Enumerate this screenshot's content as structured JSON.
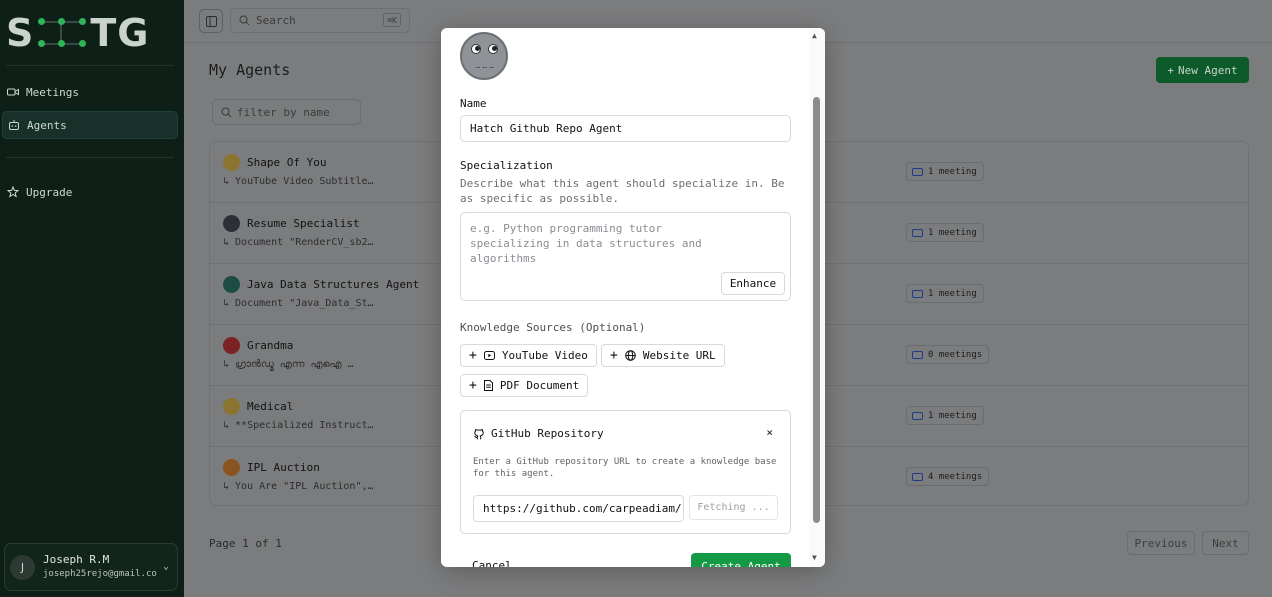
{
  "app": {
    "logo_left": "S",
    "logo_right": "TG"
  },
  "sidebar": {
    "items": [
      {
        "label": "Meetings",
        "icon": "video-icon"
      },
      {
        "label": "Agents",
        "icon": "bot-icon"
      },
      {
        "label": "Upgrade",
        "icon": "star-icon"
      }
    ],
    "user": {
      "initial": "J",
      "name": "Joseph R.M",
      "email": "joseph25rejo@gmail.co"
    }
  },
  "topbar": {
    "search_placeholder": "Search",
    "shortcut": "⌘K"
  },
  "page": {
    "title": "My Agents",
    "new_agent_label": "New Agent",
    "filter_placeholder": "filter by name",
    "pagination": {
      "info": "Page 1 of 1",
      "previous": "Previous",
      "next": "Next"
    }
  },
  "agents": [
    {
      "name": "Shape Of You",
      "desc": "↳ YouTube Video Subtitle…",
      "meetings": "1 meeting",
      "color": "#c9a42c"
    },
    {
      "name": "Resume Specialist",
      "desc": "↳ Document \"RenderCV_sb2…",
      "meetings": "1 meeting",
      "color": "#3b4048"
    },
    {
      "name": "Java Data Structures Agent",
      "desc": "↳ Document \"Java_Data_St…",
      "meetings": "1 meeting",
      "color": "#1b6e5b"
    },
    {
      "name": "Grandma",
      "desc": "↳ ഗ്രാൻഡ്മ എന്ന എഐ …",
      "meetings": "0 meetings",
      "color": "#b1282a"
    },
    {
      "name": "Medical",
      "desc": "↳ **Specialized Instruct…",
      "meetings": "1 meeting",
      "color": "#c9a42c"
    },
    {
      "name": "IPL Auction",
      "desc": "↳ You Are \"IPL Auction\",…",
      "meetings": "4 meetings",
      "color": "#c4761f"
    }
  ],
  "modal": {
    "name_label": "Name",
    "name_value": "Hatch Github Repo Agent",
    "spec_label": "Specialization",
    "spec_help": "Describe what this agent should specialize in. Be as specific as possible.",
    "spec_placeholder": "e.g. Python programming tutor specializing in data structures and algorithms",
    "enhance_label": "Enhance",
    "ks_label": "Knowledge Sources (Optional)",
    "sources": {
      "youtube": "YouTube Video",
      "website": "Website URL",
      "pdf": "PDF Document"
    },
    "github": {
      "title": "GitHub Repository",
      "close": "×",
      "help": "Enter a GitHub repository URL to create a knowledge base for this agent.",
      "url_value": "https://github.com/carpeadiam/",
      "fetch_label": "Fetching ..."
    },
    "cancel_label": "Cancel",
    "create_label": "Create Agent"
  },
  "colors": {
    "sidebar_bg": "#0e1f17",
    "primary": "#149a45",
    "meeting_icon": "#1d3b8a"
  }
}
